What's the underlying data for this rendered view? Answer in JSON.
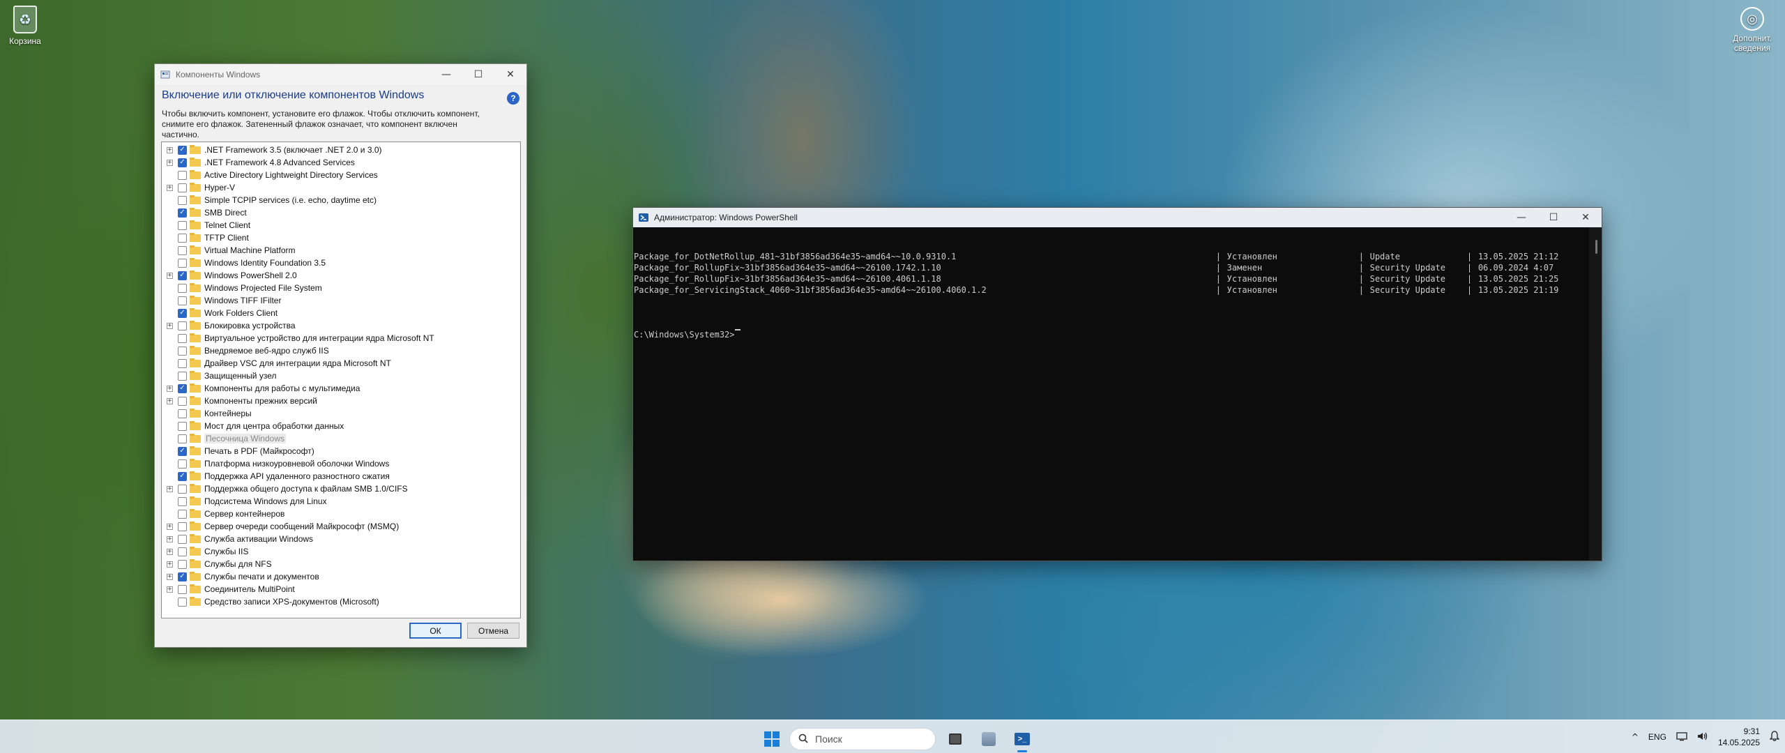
{
  "desktop": {
    "recycle_bin_label": "Корзина",
    "more_info_label": "Дополнит. сведения"
  },
  "features_dialog": {
    "title": "Компоненты Windows",
    "heading": "Включение или отключение компонентов Windows",
    "description": "Чтобы включить компонент, установите его флажок. Чтобы отключить компонент, снимите его флажок. Затененный флажок означает, что компонент включен частично.",
    "items": [
      {
        "label": ".NET Framework 3.5 (включает .NET 2.0 и 3.0)",
        "expandable": true,
        "checked": true
      },
      {
        "label": ".NET Framework 4.8 Advanced Services",
        "expandable": true,
        "checked": true
      },
      {
        "label": "Active Directory Lightweight Directory Services",
        "expandable": false,
        "checked": false
      },
      {
        "label": "Hyper-V",
        "expandable": true,
        "checked": false
      },
      {
        "label": "Simple TCPIP services (i.e. echo, daytime etc)",
        "expandable": false,
        "checked": false
      },
      {
        "label": "SMB Direct",
        "expandable": false,
        "checked": true
      },
      {
        "label": "Telnet Client",
        "expandable": false,
        "checked": false
      },
      {
        "label": "TFTP Client",
        "expandable": false,
        "checked": false
      },
      {
        "label": "Virtual Machine Platform",
        "expandable": false,
        "checked": false
      },
      {
        "label": "Windows Identity Foundation 3.5",
        "expandable": false,
        "checked": false
      },
      {
        "label": "Windows PowerShell 2.0",
        "expandable": true,
        "checked": true
      },
      {
        "label": "Windows Projected File System",
        "expandable": false,
        "checked": false
      },
      {
        "label": "Windows TIFF IFilter",
        "expandable": false,
        "checked": false
      },
      {
        "label": "Work Folders Client",
        "expandable": false,
        "checked": true
      },
      {
        "label": "Блокировка устройства",
        "expandable": true,
        "checked": false
      },
      {
        "label": "Виртуальное устройство для интеграции ядра Microsoft NT",
        "expandable": false,
        "checked": false
      },
      {
        "label": "Внедряемое веб-ядро служб IIS",
        "expandable": false,
        "checked": false
      },
      {
        "label": "Драйвер VSC для интеграции ядра Microsoft NT",
        "expandable": false,
        "checked": false
      },
      {
        "label": "Защищенный узел",
        "expandable": false,
        "checked": false
      },
      {
        "label": "Компоненты для работы с мультимедиа",
        "expandable": true,
        "checked": true
      },
      {
        "label": "Компоненты прежних версий",
        "expandable": true,
        "checked": false
      },
      {
        "label": "Контейнеры",
        "expandable": false,
        "checked": false
      },
      {
        "label": "Мост для центра обработки данных",
        "expandable": false,
        "checked": false
      },
      {
        "label": "Песочница Windows",
        "expandable": false,
        "checked": false,
        "disabled": true
      },
      {
        "label": "Печать в PDF (Майкрософт)",
        "expandable": false,
        "checked": true
      },
      {
        "label": "Платформа низкоуровневой оболочки Windows",
        "expandable": false,
        "checked": false
      },
      {
        "label": "Поддержка API удаленного разностного сжатия",
        "expandable": false,
        "checked": true
      },
      {
        "label": "Поддержка общего доступа к файлам SMB 1.0/CIFS",
        "expandable": true,
        "checked": false
      },
      {
        "label": "Подсистема Windows для Linux",
        "expandable": false,
        "checked": false
      },
      {
        "label": "Сервер контейнеров",
        "expandable": false,
        "checked": false
      },
      {
        "label": "Сервер очереди сообщений Майкрософт (MSMQ)",
        "expandable": true,
        "checked": false
      },
      {
        "label": "Служба активации Windows",
        "expandable": true,
        "checked": false
      },
      {
        "label": "Службы IIS",
        "expandable": true,
        "checked": false
      },
      {
        "label": "Службы для NFS",
        "expandable": true,
        "checked": false
      },
      {
        "label": "Службы печати и документов",
        "expandable": true,
        "checked": true
      },
      {
        "label": "Соединитель MultiPoint",
        "expandable": true,
        "checked": false
      },
      {
        "label": "Средство записи XPS-документов (Microsoft)",
        "expandable": false,
        "checked": false
      }
    ],
    "ok_label": "ОК",
    "cancel_label": "Отмена"
  },
  "powershell": {
    "title": "Администратор: Windows PowerShell",
    "rows": [
      {
        "name": "Package_for_DotNetRollup_481~31bf3856ad364e35~amd64~~10.0.9310.1",
        "state": "Установлен",
        "type": "Update",
        "date": "13.05.2025 21:12"
      },
      {
        "name": "Package_for_RollupFix~31bf3856ad364e35~amd64~~26100.1742.1.10",
        "state": "Заменен",
        "type": "Security Update",
        "date": "06.09.2024 4:07"
      },
      {
        "name": "Package_for_RollupFix~31bf3856ad364e35~amd64~~26100.4061.1.18",
        "state": "Установлен",
        "type": "Security Update",
        "date": "13.05.2025 21:25"
      },
      {
        "name": "Package_for_ServicingStack_4060~31bf3856ad364e35~amd64~~26100.4060.1.2",
        "state": "Установлен",
        "type": "Security Update",
        "date": "13.05.2025 21:19"
      }
    ],
    "separator": "|",
    "prompt": "C:\\Windows\\System32>"
  },
  "taskbar": {
    "search_placeholder": "Поиск",
    "language": "ENG",
    "time": "9:31",
    "date": "14.05.2025"
  },
  "colors": {
    "accent": "#2b66c9",
    "console_bg": "#0c0c0c",
    "console_fg": "#cccccc",
    "heading": "#1a3c8a"
  }
}
